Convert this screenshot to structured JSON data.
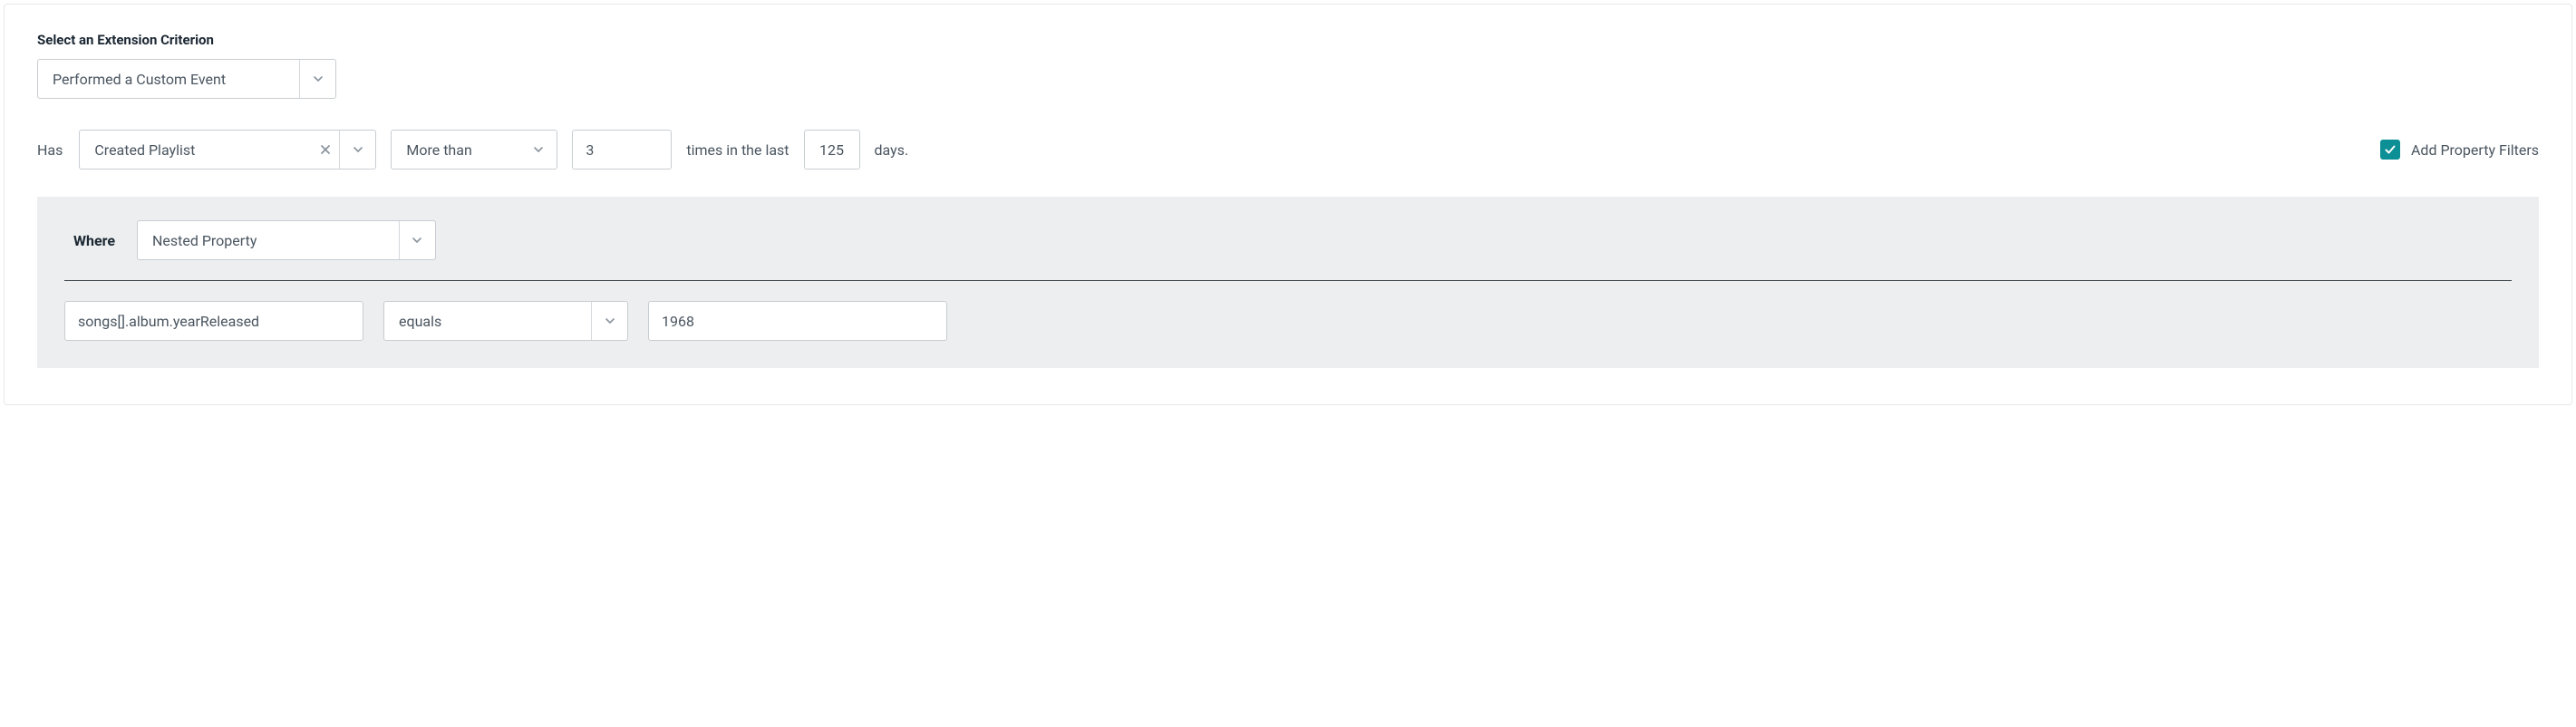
{
  "header": {
    "label": "Select an Extension Criterion"
  },
  "criterion": {
    "value": "Performed a Custom Event"
  },
  "condition": {
    "has_label": "Has",
    "event": "Created Playlist",
    "comparator": "More than",
    "count": "3",
    "mid_text": "times in the last",
    "days": "125",
    "days_suffix": "days."
  },
  "property_filters_toggle": {
    "label": "Add Property Filters",
    "checked": true
  },
  "filter": {
    "where_label": "Where",
    "filter_type": "Nested Property",
    "property_path": "songs[].album.yearReleased",
    "operator": "equals",
    "value": "1968"
  }
}
